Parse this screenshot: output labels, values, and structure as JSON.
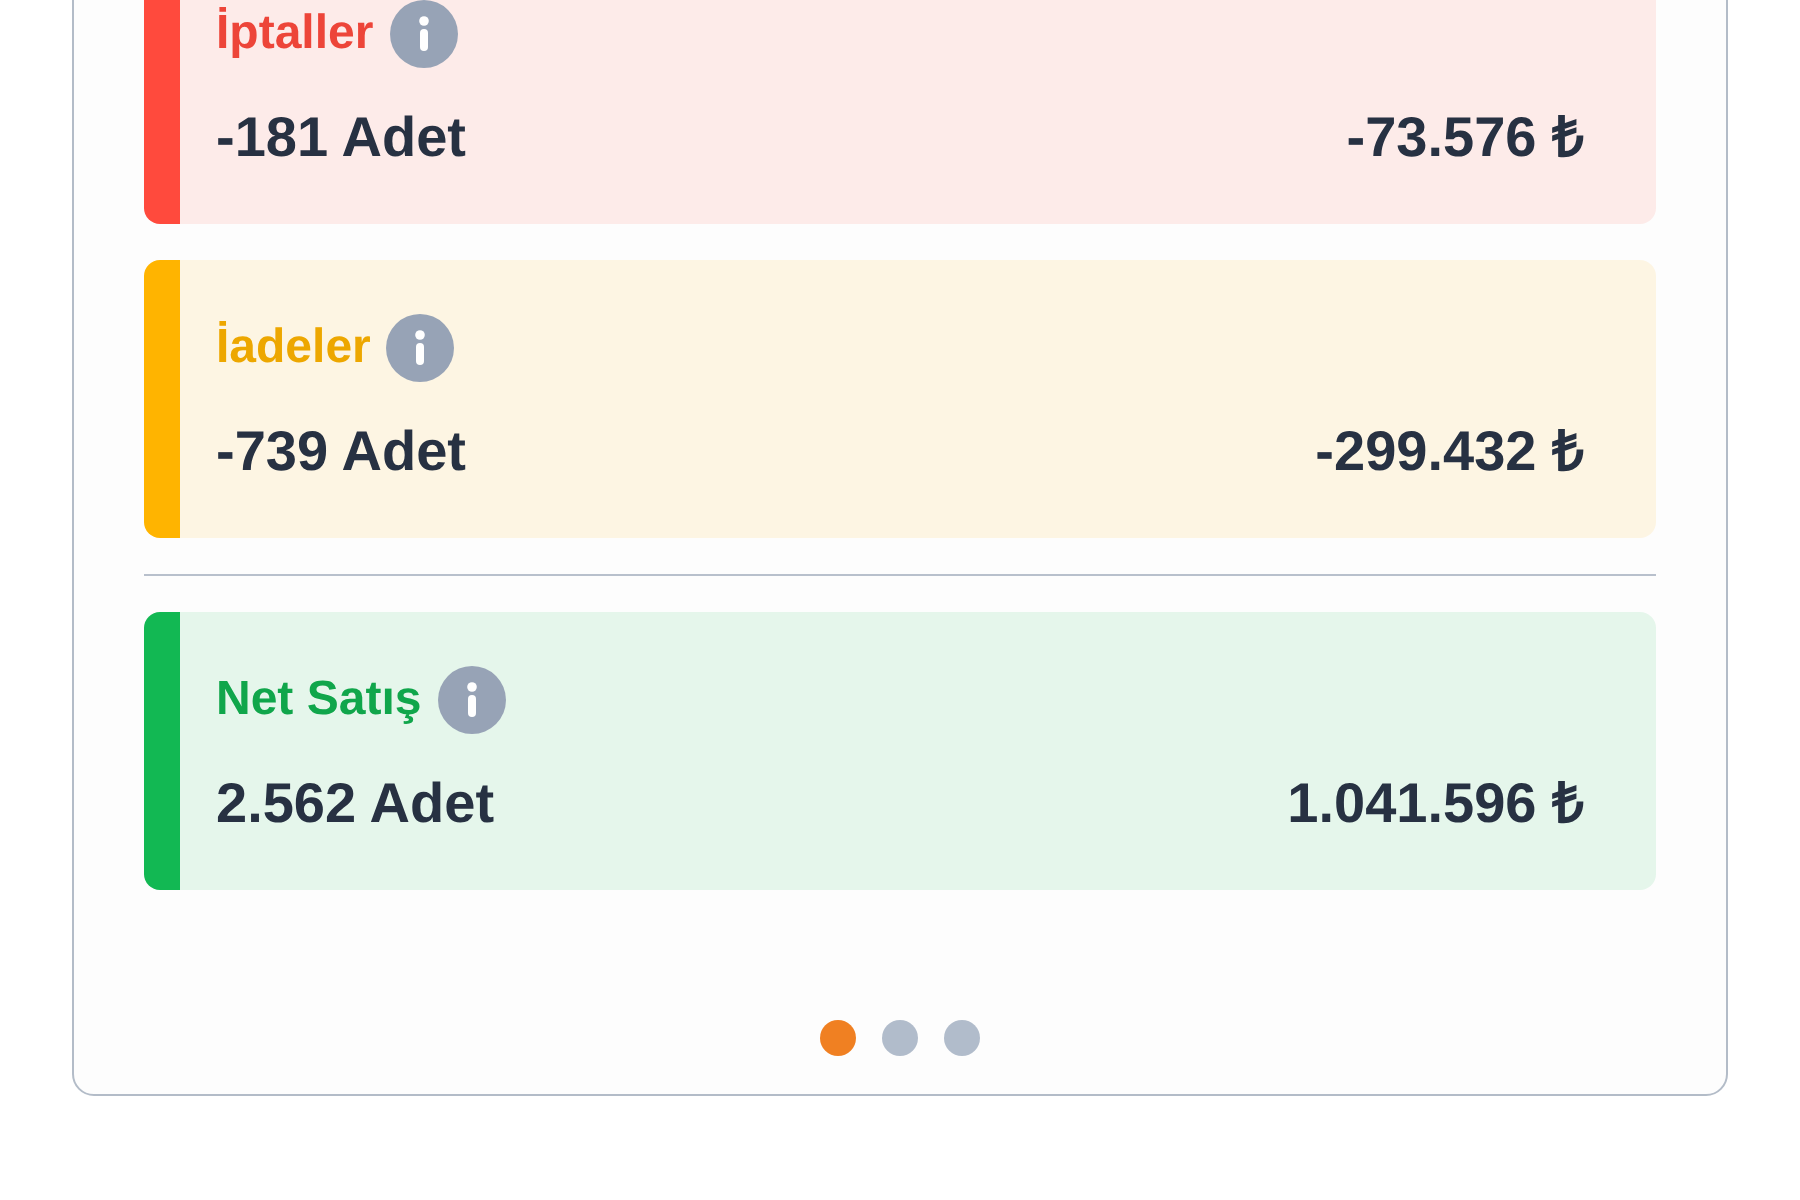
{
  "summary_card": {
    "rows": [
      {
        "title": "İptaller",
        "color": "#ff4a3d",
        "quantity": "-181 Adet",
        "amount": "-73.576 ₺"
      },
      {
        "title": "İadeler",
        "color": "#ffb400",
        "quantity": "-739 Adet",
        "amount": "-299.432 ₺"
      }
    ],
    "total": {
      "title": "Net Satış",
      "color": "#12b853",
      "quantity": "2.562 Adet",
      "amount": "1.041.596 ₺"
    },
    "pager": [
      {
        "selected": true
      },
      {
        "selected": false
      },
      {
        "selected": false
      }
    ]
  }
}
